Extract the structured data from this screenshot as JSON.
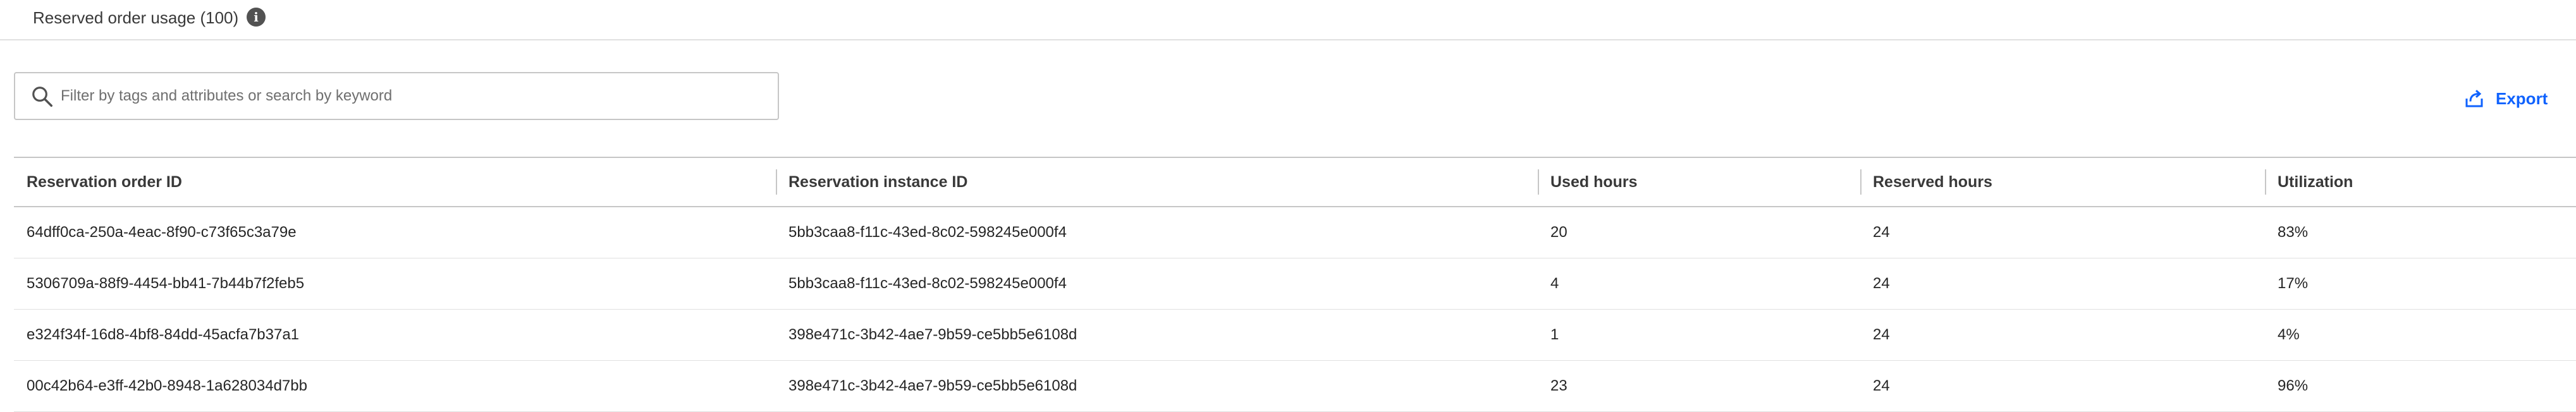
{
  "header": {
    "title": "Reserved order usage (100)",
    "info_icon": "info-icon"
  },
  "toolbar": {
    "search_placeholder": "Filter by tags and attributes or search by keyword",
    "search_value": "",
    "export_label": "Export",
    "accent_color": "#0f62fe"
  },
  "table": {
    "columns": [
      "Reservation order ID",
      "Reservation instance ID",
      "Used hours",
      "Reserved hours",
      "Utilization"
    ],
    "rows": [
      [
        "64dff0ca-250a-4eac-8f90-c73f65c3a79e",
        "5bb3caa8-f11c-43ed-8c02-598245e000f4",
        "20",
        "24",
        "83%"
      ],
      [
        "5306709a-88f9-4454-bb41-7b44b7f2feb5",
        "5bb3caa8-f11c-43ed-8c02-598245e000f4",
        "4",
        "24",
        "17%"
      ],
      [
        "e324f34f-16d8-4bf8-84dd-45acfa7b37a1",
        "398e471c-3b42-4ae7-9b59-ce5bb5e6108d",
        "1",
        "24",
        "4%"
      ],
      [
        "00c42b64-e3ff-42b0-8948-1a628034d7bb",
        "398e471c-3b42-4ae7-9b59-ce5bb5e6108d",
        "23",
        "24",
        "96%"
      ]
    ]
  }
}
